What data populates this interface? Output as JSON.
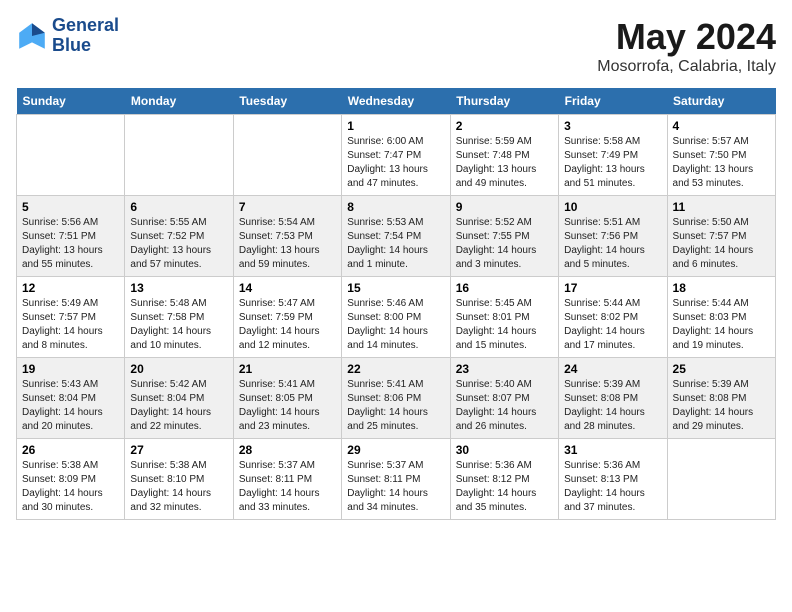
{
  "header": {
    "logo_line1": "General",
    "logo_line2": "Blue",
    "month_title": "May 2024",
    "location": "Mosorrofa, Calabria, Italy"
  },
  "days_of_week": [
    "Sunday",
    "Monday",
    "Tuesday",
    "Wednesday",
    "Thursday",
    "Friday",
    "Saturday"
  ],
  "weeks": [
    [
      {
        "day": "",
        "info": ""
      },
      {
        "day": "",
        "info": ""
      },
      {
        "day": "",
        "info": ""
      },
      {
        "day": "1",
        "info": "Sunrise: 6:00 AM\nSunset: 7:47 PM\nDaylight: 13 hours\nand 47 minutes."
      },
      {
        "day": "2",
        "info": "Sunrise: 5:59 AM\nSunset: 7:48 PM\nDaylight: 13 hours\nand 49 minutes."
      },
      {
        "day": "3",
        "info": "Sunrise: 5:58 AM\nSunset: 7:49 PM\nDaylight: 13 hours\nand 51 minutes."
      },
      {
        "day": "4",
        "info": "Sunrise: 5:57 AM\nSunset: 7:50 PM\nDaylight: 13 hours\nand 53 minutes."
      }
    ],
    [
      {
        "day": "5",
        "info": "Sunrise: 5:56 AM\nSunset: 7:51 PM\nDaylight: 13 hours\nand 55 minutes."
      },
      {
        "day": "6",
        "info": "Sunrise: 5:55 AM\nSunset: 7:52 PM\nDaylight: 13 hours\nand 57 minutes."
      },
      {
        "day": "7",
        "info": "Sunrise: 5:54 AM\nSunset: 7:53 PM\nDaylight: 13 hours\nand 59 minutes."
      },
      {
        "day": "8",
        "info": "Sunrise: 5:53 AM\nSunset: 7:54 PM\nDaylight: 14 hours\nand 1 minute."
      },
      {
        "day": "9",
        "info": "Sunrise: 5:52 AM\nSunset: 7:55 PM\nDaylight: 14 hours\nand 3 minutes."
      },
      {
        "day": "10",
        "info": "Sunrise: 5:51 AM\nSunset: 7:56 PM\nDaylight: 14 hours\nand 5 minutes."
      },
      {
        "day": "11",
        "info": "Sunrise: 5:50 AM\nSunset: 7:57 PM\nDaylight: 14 hours\nand 6 minutes."
      }
    ],
    [
      {
        "day": "12",
        "info": "Sunrise: 5:49 AM\nSunset: 7:57 PM\nDaylight: 14 hours\nand 8 minutes."
      },
      {
        "day": "13",
        "info": "Sunrise: 5:48 AM\nSunset: 7:58 PM\nDaylight: 14 hours\nand 10 minutes."
      },
      {
        "day": "14",
        "info": "Sunrise: 5:47 AM\nSunset: 7:59 PM\nDaylight: 14 hours\nand 12 minutes."
      },
      {
        "day": "15",
        "info": "Sunrise: 5:46 AM\nSunset: 8:00 PM\nDaylight: 14 hours\nand 14 minutes."
      },
      {
        "day": "16",
        "info": "Sunrise: 5:45 AM\nSunset: 8:01 PM\nDaylight: 14 hours\nand 15 minutes."
      },
      {
        "day": "17",
        "info": "Sunrise: 5:44 AM\nSunset: 8:02 PM\nDaylight: 14 hours\nand 17 minutes."
      },
      {
        "day": "18",
        "info": "Sunrise: 5:44 AM\nSunset: 8:03 PM\nDaylight: 14 hours\nand 19 minutes."
      }
    ],
    [
      {
        "day": "19",
        "info": "Sunrise: 5:43 AM\nSunset: 8:04 PM\nDaylight: 14 hours\nand 20 minutes."
      },
      {
        "day": "20",
        "info": "Sunrise: 5:42 AM\nSunset: 8:04 PM\nDaylight: 14 hours\nand 22 minutes."
      },
      {
        "day": "21",
        "info": "Sunrise: 5:41 AM\nSunset: 8:05 PM\nDaylight: 14 hours\nand 23 minutes."
      },
      {
        "day": "22",
        "info": "Sunrise: 5:41 AM\nSunset: 8:06 PM\nDaylight: 14 hours\nand 25 minutes."
      },
      {
        "day": "23",
        "info": "Sunrise: 5:40 AM\nSunset: 8:07 PM\nDaylight: 14 hours\nand 26 minutes."
      },
      {
        "day": "24",
        "info": "Sunrise: 5:39 AM\nSunset: 8:08 PM\nDaylight: 14 hours\nand 28 minutes."
      },
      {
        "day": "25",
        "info": "Sunrise: 5:39 AM\nSunset: 8:08 PM\nDaylight: 14 hours\nand 29 minutes."
      }
    ],
    [
      {
        "day": "26",
        "info": "Sunrise: 5:38 AM\nSunset: 8:09 PM\nDaylight: 14 hours\nand 30 minutes."
      },
      {
        "day": "27",
        "info": "Sunrise: 5:38 AM\nSunset: 8:10 PM\nDaylight: 14 hours\nand 32 minutes."
      },
      {
        "day": "28",
        "info": "Sunrise: 5:37 AM\nSunset: 8:11 PM\nDaylight: 14 hours\nand 33 minutes."
      },
      {
        "day": "29",
        "info": "Sunrise: 5:37 AM\nSunset: 8:11 PM\nDaylight: 14 hours\nand 34 minutes."
      },
      {
        "day": "30",
        "info": "Sunrise: 5:36 AM\nSunset: 8:12 PM\nDaylight: 14 hours\nand 35 minutes."
      },
      {
        "day": "31",
        "info": "Sunrise: 5:36 AM\nSunset: 8:13 PM\nDaylight: 14 hours\nand 37 minutes."
      },
      {
        "day": "",
        "info": ""
      }
    ]
  ]
}
